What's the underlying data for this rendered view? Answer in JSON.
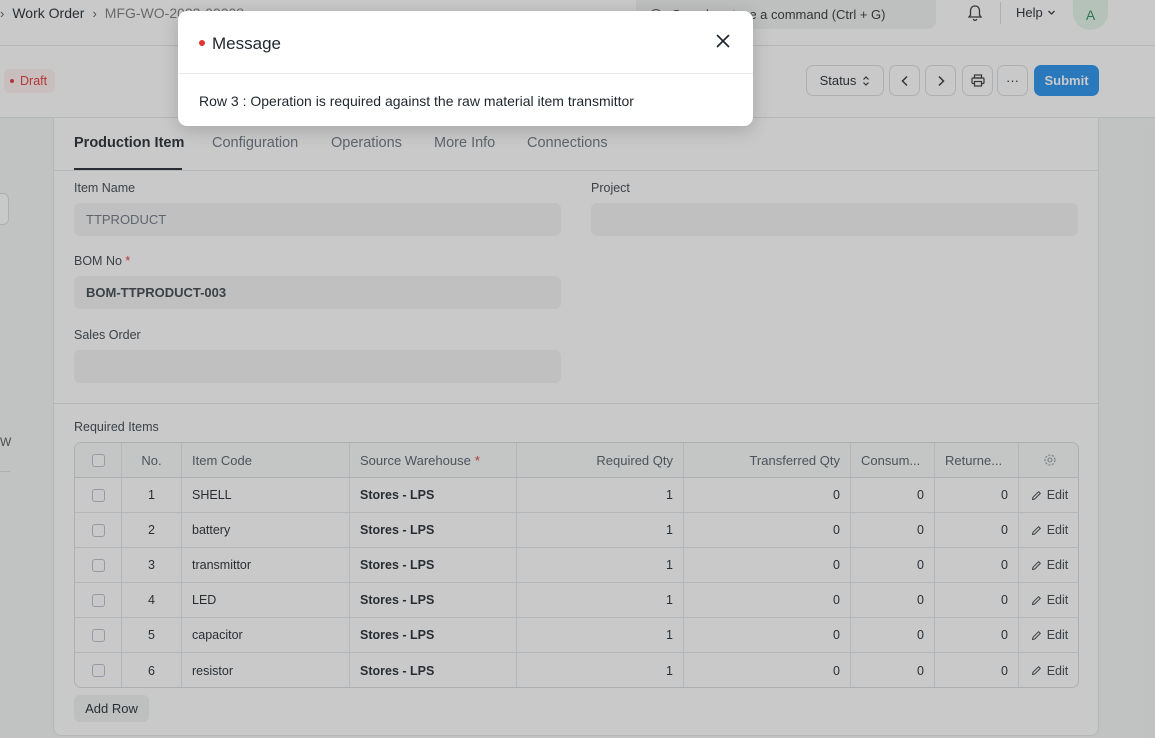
{
  "navbar": {
    "breadcrumb_root": "Work Order",
    "breadcrumb_current": "MFG-WO-2023-00008",
    "search_placeholder": "Search or type a command (Ctrl + G)",
    "help_label": "Help",
    "avatar_initial": "A"
  },
  "pagehead": {
    "status_badge": "Draft",
    "status_button": "Status",
    "more_label": "···",
    "submit_label": "Submit"
  },
  "sidebar": {
    "partial_text": "W"
  },
  "tabs": [
    "Production Item",
    "Configuration",
    "Operations",
    "More Info",
    "Connections"
  ],
  "form": {
    "item_name_label": "Item Name",
    "item_name_value": "TTPRODUCT",
    "project_label": "Project",
    "project_value": "",
    "bom_label": "BOM No",
    "bom_value": "BOM-TTPRODUCT-003",
    "sales_order_label": "Sales Order",
    "sales_order_value": "",
    "required_marker": "*"
  },
  "required_items": {
    "title": "Required Items",
    "columns": [
      "No.",
      "Item Code",
      "Source Warehouse",
      "Required Qty",
      "Transferred Qty",
      "Consum...",
      "Returne..."
    ],
    "edit_label": "Edit",
    "rows": [
      {
        "no": "1",
        "item_code": "SHELL",
        "warehouse": "Stores - LPS",
        "required_qty": "1",
        "transferred_qty": "0",
        "consumed": "0",
        "returned": "0"
      },
      {
        "no": "2",
        "item_code": "battery",
        "warehouse": "Stores - LPS",
        "required_qty": "1",
        "transferred_qty": "0",
        "consumed": "0",
        "returned": "0"
      },
      {
        "no": "3",
        "item_code": "transmittor",
        "warehouse": "Stores - LPS",
        "required_qty": "1",
        "transferred_qty": "0",
        "consumed": "0",
        "returned": "0"
      },
      {
        "no": "4",
        "item_code": "LED",
        "warehouse": "Stores - LPS",
        "required_qty": "1",
        "transferred_qty": "0",
        "consumed": "0",
        "returned": "0"
      },
      {
        "no": "5",
        "item_code": "capacitor",
        "warehouse": "Stores - LPS",
        "required_qty": "1",
        "transferred_qty": "0",
        "consumed": "0",
        "returned": "0"
      },
      {
        "no": "6",
        "item_code": "resistor",
        "warehouse": "Stores - LPS",
        "required_qty": "1",
        "transferred_qty": "0",
        "consumed": "0",
        "returned": "0"
      }
    ],
    "add_row_label": "Add Row"
  },
  "dialog": {
    "title": "Message",
    "message": "Row 3 : Operation is required against the raw material item transmittor"
  },
  "colors": {
    "primary": "#2490ef",
    "danger": "#e03636",
    "text": "#1f272e"
  }
}
